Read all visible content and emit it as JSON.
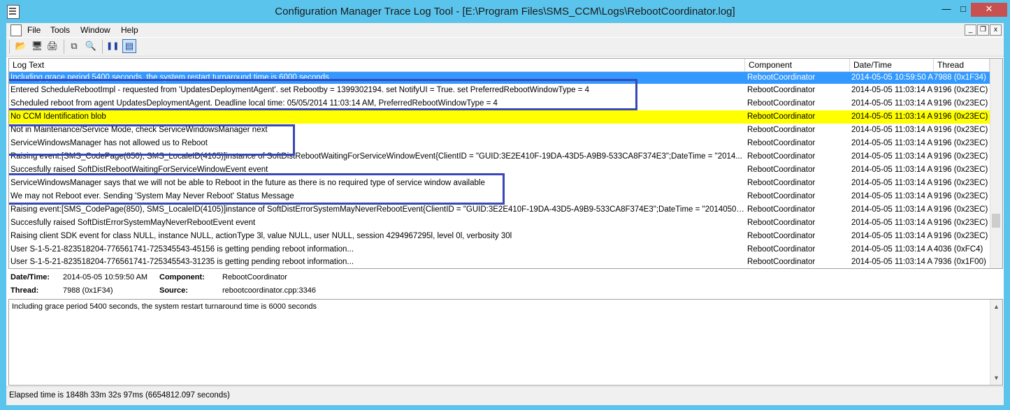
{
  "window": {
    "title": "Configuration Manager Trace Log Tool - [E:\\Program Files\\SMS_CCM\\Logs\\RebootCoordinator.log]",
    "buttons": {
      "minimize": "—",
      "maximize": "□",
      "close": "✕"
    }
  },
  "menu": {
    "file": "File",
    "tools": "Tools",
    "window": "Window",
    "help": "Help"
  },
  "mdi_buttons": {
    "minimize": "_",
    "restore": "❐",
    "close": "x"
  },
  "toolbar": {
    "icons": [
      "open-icon",
      "print-setup-icon",
      "print-icon",
      "copy-icon",
      "find-icon",
      "pause-icon",
      "highlight-icon"
    ],
    "glyphs": {
      "open": "📂",
      "print_setup": "🖥",
      "print": "🖨",
      "copy": "⧉",
      "find": "🔍",
      "pause": "❚❚",
      "highlight": "▤"
    }
  },
  "grid": {
    "columns": {
      "log_text": "Log Text",
      "component": "Component",
      "datetime": "Date/Time",
      "thread": "Thread"
    },
    "rows": [
      {
        "text": "Including grace period 5400 seconds, the system restart turnaround time is 6000 seconds",
        "component": "RebootCoordinator",
        "datetime": "2014-05-05 10:59:50 A",
        "thread": "7988 (0x1F34)",
        "state": "selected"
      },
      {
        "text": "Entered ScheduleRebootImpl - requested from 'UpdatesDeploymentAgent'. set Rebootby = 1399302194. set NotifyUI = True. set PreferredRebootWindowType = 4",
        "component": "RebootCoordinator",
        "datetime": "2014-05-05 11:03:14 A",
        "thread": "9196 (0x23EC)",
        "state": "normal"
      },
      {
        "text": "Scheduled reboot from agent UpdatesDeploymentAgent. Deadline local time: 05/05/2014 11:03:14 AM, PreferredRebootWindowType = 4",
        "component": "RebootCoordinator",
        "datetime": "2014-05-05 11:03:14 A",
        "thread": "9196 (0x23EC)",
        "state": "normal"
      },
      {
        "text": "No CCM Identification blob",
        "component": "RebootCoordinator",
        "datetime": "2014-05-05 11:03:14 A",
        "thread": "9196 (0x23EC)",
        "state": "warning"
      },
      {
        "text": "Not in Maintenance/Service Mode, check ServiceWindowsManager next",
        "component": "RebootCoordinator",
        "datetime": "2014-05-05 11:03:14 A",
        "thread": "9196 (0x23EC)",
        "state": "normal"
      },
      {
        "text": "ServiceWindowsManager has not allowed us to Reboot",
        "component": "RebootCoordinator",
        "datetime": "2014-05-05 11:03:14 A",
        "thread": "9196 (0x23EC)",
        "state": "normal"
      },
      {
        "text": "Raising event:[SMS_CodePage(850), SMS_LocaleID(4105)]instance of SoftDistRebootWaitingForServiceWindowEvent{ClientID = \"GUID:3E2E410F-19DA-43D5-A9B9-533CA8F374E3\";DateTime = \"2014...",
        "component": "RebootCoordinator",
        "datetime": "2014-05-05 11:03:14 A",
        "thread": "9196 (0x23EC)",
        "state": "normal"
      },
      {
        "text": "Succesfully raised SoftDistRebootWaitingForServiceWindowEvent event",
        "component": "RebootCoordinator",
        "datetime": "2014-05-05 11:03:14 A",
        "thread": "9196 (0x23EC)",
        "state": "normal"
      },
      {
        "text": "ServiceWindowsManager says that we will not be able to Reboot in the future as there is no required type of service window available",
        "component": "RebootCoordinator",
        "datetime": "2014-05-05 11:03:14 A",
        "thread": "9196 (0x23EC)",
        "state": "normal"
      },
      {
        "text": "We may not Reboot ever. Sending 'System May Never Reboot' Status Message",
        "component": "RebootCoordinator",
        "datetime": "2014-05-05 11:03:14 A",
        "thread": "9196 (0x23EC)",
        "state": "normal"
      },
      {
        "text": "Raising event:[SMS_CodePage(850), SMS_LocaleID(4105)]instance of SoftDistErrorSystemMayNeverRebootEvent{ClientID = \"GUID:3E2E410F-19DA-43D5-A9B9-533CA8F374E3\";DateTime = \"20140505...",
        "component": "RebootCoordinator",
        "datetime": "2014-05-05 11:03:14 A",
        "thread": "9196 (0x23EC)",
        "state": "normal"
      },
      {
        "text": "Succesfully raised SoftDistErrorSystemMayNeverRebootEvent event",
        "component": "RebootCoordinator",
        "datetime": "2014-05-05 11:03:14 A",
        "thread": "9196 (0x23EC)",
        "state": "normal"
      },
      {
        "text": "Raising client SDK event for class NULL, instance NULL, actionType 3l, value NULL, user NULL, session 4294967295l, level 0l, verbosity 30l",
        "component": "RebootCoordinator",
        "datetime": "2014-05-05 11:03:14 A",
        "thread": "9196 (0x23EC)",
        "state": "normal"
      },
      {
        "text": "User S-1-5-21-823518204-776561741-725345543-45156 is getting pending reboot information...",
        "component": "RebootCoordinator",
        "datetime": "2014-05-05 11:03:14 A",
        "thread": "4036 (0xFC4)",
        "state": "normal"
      },
      {
        "text": "User S-1-5-21-823518204-776561741-725345543-31235 is getting pending reboot information...",
        "component": "RebootCoordinator",
        "datetime": "2014-05-05 11:03:14 A",
        "thread": "7936 (0x1F00)",
        "state": "clipped"
      }
    ]
  },
  "details": {
    "datetime_label": "Date/Time:",
    "datetime_value": "2014-05-05 10:59:50 AM",
    "component_label": "Component:",
    "component_value": "RebootCoordinator",
    "thread_label": "Thread:",
    "thread_value": "7988 (0x1F34)",
    "source_label": "Source:",
    "source_value": "rebootcoordinator.cpp:3346"
  },
  "message": "Including grace period 5400 seconds, the system restart turnaround time is 6000 seconds",
  "status": "Elapsed time is 1848h 33m 32s 97ms (6654812.097 seconds)",
  "colors": {
    "titlebar": "#5bc4ec",
    "selected_row": "#3399ff",
    "warning_row": "#ffff00",
    "highlight_box": "#3848b8",
    "close_button": "#c75050"
  }
}
